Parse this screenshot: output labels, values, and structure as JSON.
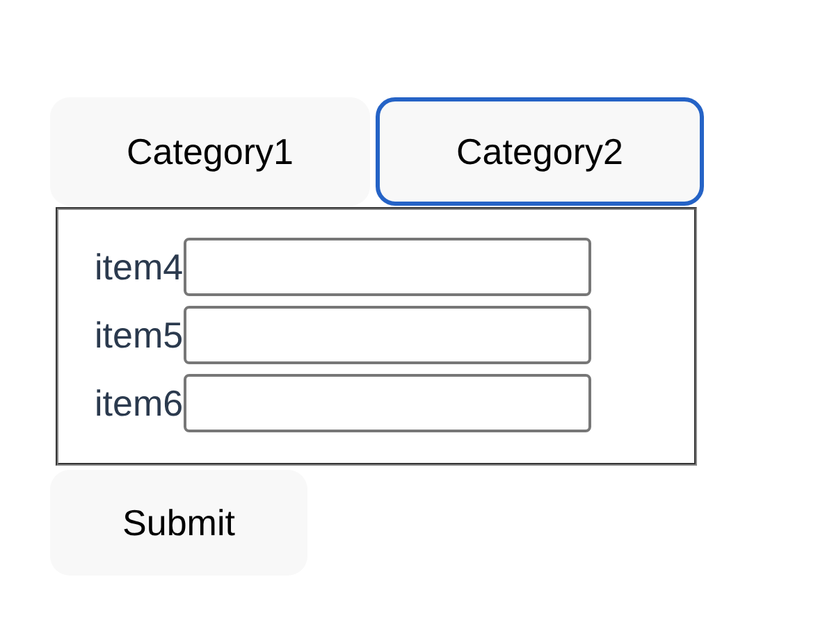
{
  "tabs": [
    {
      "label": "Category1",
      "selected": false
    },
    {
      "label": "Category2",
      "selected": true
    }
  ],
  "fields": [
    {
      "label": "item4"
    },
    {
      "label": "item5"
    },
    {
      "label": "item6"
    }
  ],
  "submit": {
    "label": "Submit"
  }
}
